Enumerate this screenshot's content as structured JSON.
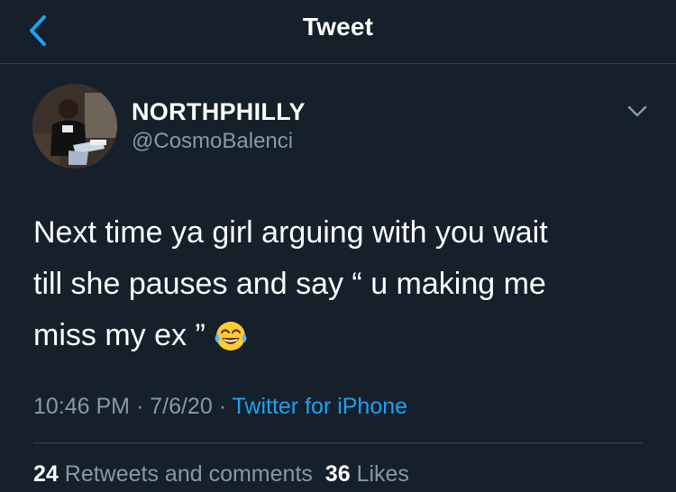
{
  "header": {
    "title": "Tweet",
    "back_icon": "chevron-left-icon",
    "accent": "#1da1f2"
  },
  "author": {
    "name": "NORTHPHILLY",
    "handle": "@CosmoBalenci"
  },
  "tweet": {
    "text_lines": [
      "Next time ya girl arguing with you wait",
      "till she pauses and say “ u making me",
      "miss my ex ”"
    ],
    "emoji": "face-with-tears-of-joy-icon",
    "time": "10:46 PM",
    "sep1": " · ",
    "date": "7/6/20",
    "sep2": " · ",
    "source": "Twitter for iPhone"
  },
  "stats": {
    "retweets_count": "24",
    "retweets_label": "Retweets and comments",
    "likes_count": "36",
    "likes_label": "Likes"
  }
}
